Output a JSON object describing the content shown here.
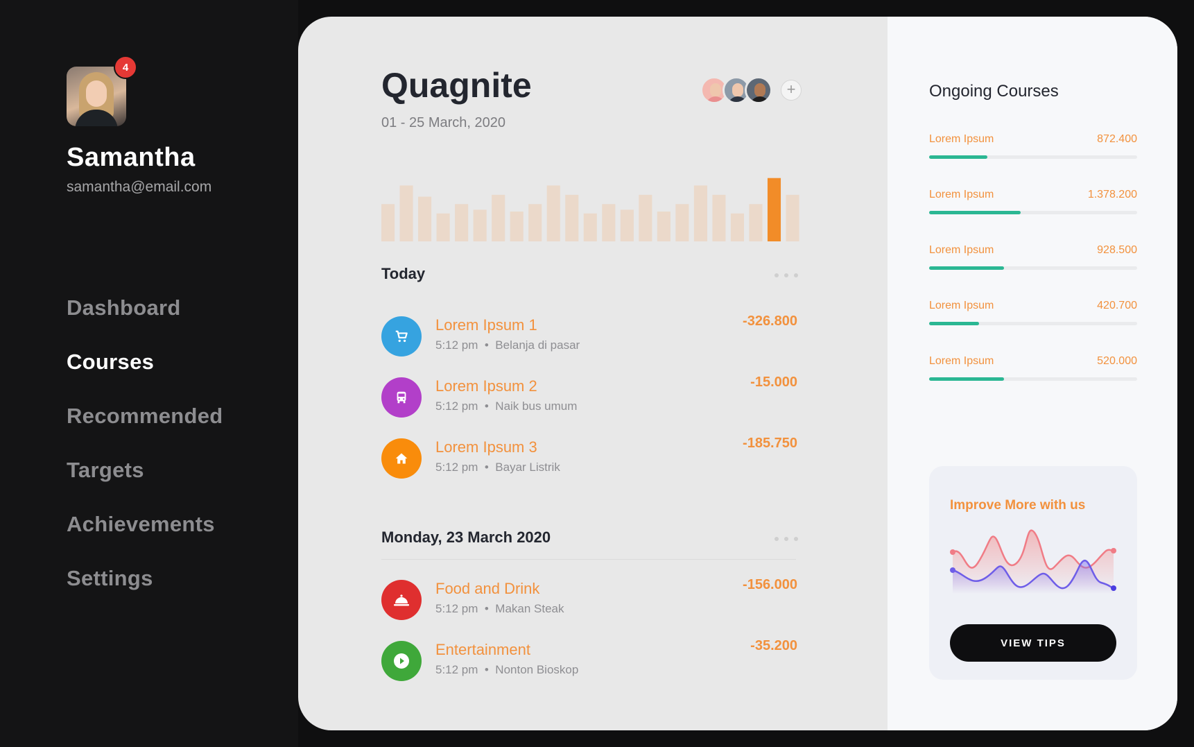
{
  "user": {
    "name": "Samantha",
    "email": "samantha@email.com",
    "notifications": "4"
  },
  "nav": {
    "items": [
      {
        "label": "Dashboard",
        "active": false
      },
      {
        "label": "Courses",
        "active": true
      },
      {
        "label": "Recommended",
        "active": false
      },
      {
        "label": "Targets",
        "active": false
      },
      {
        "label": "Achievements",
        "active": false
      },
      {
        "label": "Settings",
        "active": false
      }
    ]
  },
  "header": {
    "title": "Quagnite",
    "date_range": "01 - 25 March, 2020",
    "add_icon": "plus-icon"
  },
  "activity_bars": {
    "values": [
      40,
      60,
      48,
      30,
      40,
      34,
      50,
      32,
      40,
      60,
      50,
      30,
      40,
      34,
      50,
      32,
      40,
      60,
      50,
      30,
      40,
      68,
      50
    ],
    "highlight_index": 21,
    "color": "#f4a261",
    "highlight_color": "#f28c28"
  },
  "today": {
    "heading": "Today",
    "items": [
      {
        "title": "Lorem Ipsum 1",
        "time": "5:12 pm",
        "note": "Belanja di pasar",
        "amount": "-326.800",
        "icon": "cart-icon",
        "color": "#36a3e0"
      },
      {
        "title": "Lorem Ipsum 2",
        "time": "5:12 pm",
        "note": "Naik bus umum",
        "amount": "-15.000",
        "icon": "bus-icon",
        "color": "#b23fc9"
      },
      {
        "title": "Lorem Ipsum 3",
        "time": "5:12 pm",
        "note": "Bayar Listrik",
        "amount": "-185.750",
        "icon": "home-icon",
        "color": "#f98c0b"
      }
    ]
  },
  "monday": {
    "heading": "Monday, 23 March 2020",
    "items": [
      {
        "title": "Food and Drink",
        "time": "5:12 pm",
        "note": "Makan Steak",
        "amount": "-156.000",
        "icon": "food-cloche-icon",
        "color": "#df2f2f"
      },
      {
        "title": "Entertainment",
        "time": "5:12 pm",
        "note": "Nonton Bioskop",
        "amount": "-35.200",
        "icon": "play-icon",
        "color": "#3fa83a"
      }
    ]
  },
  "ongoing": {
    "title": "Ongoing Courses",
    "courses": [
      {
        "name": "Lorem Ipsum",
        "value": "872.400",
        "progress": 0.28
      },
      {
        "name": "Lorem Ipsum",
        "value": "1.378.200",
        "progress": 0.44
      },
      {
        "name": "Lorem Ipsum",
        "value": "928.500",
        "progress": 0.36
      },
      {
        "name": "Lorem Ipsum",
        "value": "420.700",
        "progress": 0.24
      },
      {
        "name": "Lorem Ipsum",
        "value": "520.000",
        "progress": 0.36
      }
    ]
  },
  "promo": {
    "title": "Improve More with us",
    "button": "VIEW TIPS"
  },
  "colors": {
    "accent": "#f2913d",
    "progress": "#2bb793",
    "dark": "#23262f"
  }
}
